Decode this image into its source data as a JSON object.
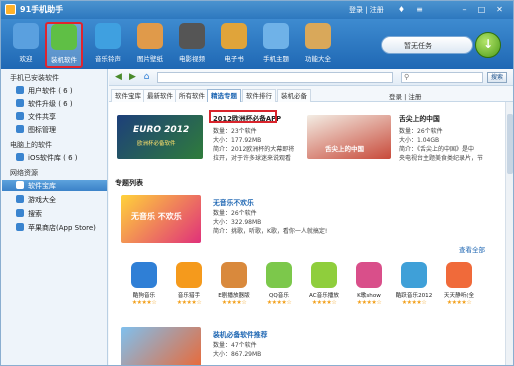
{
  "window": {
    "title": "91手机助手",
    "links": "登录 | 注册"
  },
  "toolbar": {
    "items": [
      {
        "label": "欢迎",
        "icon": "computer-icon",
        "color": "#5aa0df"
      },
      {
        "label": "装机软件",
        "icon": "apps-icon",
        "color": "#5fbf45",
        "active": true
      },
      {
        "label": "音乐铃声",
        "icon": "music-icon",
        "color": "#3fa0e0"
      },
      {
        "label": "图片壁纸",
        "icon": "picture-icon",
        "color": "#e09a4a"
      },
      {
        "label": "电影视频",
        "icon": "film-icon",
        "color": "#555555"
      },
      {
        "label": "电子书",
        "icon": "book-icon",
        "color": "#e0a43a"
      },
      {
        "label": "手机主题",
        "icon": "theme-icon",
        "color": "#6fb2e8"
      },
      {
        "label": "功能大全",
        "icon": "toolbox-icon",
        "color": "#d9a85a"
      }
    ],
    "search_text": "暂无任务"
  },
  "sidebar": {
    "section1": "手机已安装软件",
    "items1": [
      {
        "label": "用户软件  ( 6 )",
        "color": "#3a84cf"
      },
      {
        "label": "软件升级  ( 6 )",
        "color": "#3a84cf"
      },
      {
        "label": "文件共享",
        "color": "#3a84cf"
      },
      {
        "label": "图标管理",
        "color": "#3a84cf"
      }
    ],
    "section2": "电脑上的软件",
    "items2": [
      {
        "label": "iOS软件库  ( 6 )",
        "color": "#3a84cf"
      }
    ],
    "section3": "网络资源",
    "items3": [
      {
        "label": "软件宝库",
        "color": "#ffffff",
        "selected": true
      },
      {
        "label": "游戏大全",
        "color": "#3a84cf"
      },
      {
        "label": "搜索",
        "color": "#3a84cf"
      },
      {
        "label": "苹果商店(App Store)",
        "color": "#3a84cf"
      }
    ]
  },
  "nav": {
    "search_button": "搜索"
  },
  "tabs": {
    "items": [
      "软件宝库",
      "最新软件",
      "所有软件",
      "精选专题",
      "软件排行",
      "装机必备"
    ],
    "active_index": 3,
    "login": "登录 | 注册"
  },
  "topics": [
    {
      "title": "2012欧洲杯必备APP",
      "banner_text": "EURO 2012",
      "banner_sub": "欧洲杯必备软件",
      "count": "数量：23个软件",
      "size": "大小：177.92MB",
      "desc1": "简介：2012欧洲杯的大幕即将",
      "desc2": "拉开，对于许多球迷来说观看"
    },
    {
      "title": "舌尖上的中国",
      "banner_text": "舌尖上的中国",
      "count": "数量：26个软件",
      "size": "大小：1.04GB",
      "desc1": "简介：《舌尖上的中国》是中",
      "desc2": "央电视台主题美食类纪录片，节"
    }
  ],
  "special": {
    "heading": "专题列表",
    "topic": {
      "title": "无音乐不欢乐",
      "banner_text": "无音乐 不欢乐",
      "count": "数量：26个软件",
      "size": "大小：322.98MB",
      "desc": "简介：挑歌，听歌，K歌，看你一人就搞定!"
    },
    "view_all": "查看全部",
    "apps": [
      {
        "name": "酷狗音乐",
        "icon": "kugou-icon",
        "color": "#2f7fd6"
      },
      {
        "name": "音乐猎手",
        "icon": "music-hunter-icon",
        "color": "#f59a1c"
      },
      {
        "name": "E剧播放器版",
        "icon": "player-icon",
        "color": "#d9893c"
      },
      {
        "name": "QQ音乐",
        "icon": "qq-music-icon",
        "color": "#7cc84b"
      },
      {
        "name": "AC音乐播放",
        "icon": "ac-music-icon",
        "color": "#8fce3c"
      },
      {
        "name": "K歌show",
        "icon": "k-song-icon",
        "color": "#d94f8a"
      },
      {
        "name": "酷跃音乐2012",
        "icon": "kuyue-icon",
        "color": "#3fa0d8"
      },
      {
        "name": "天天静听(全",
        "icon": "ttpod-icon",
        "color": "#f06a3a"
      }
    ],
    "rating": "★★★★☆",
    "topic2": {
      "title": "装机必备软件推荐",
      "count": "数量：47个软件",
      "size": "大小：867.29MB"
    }
  }
}
